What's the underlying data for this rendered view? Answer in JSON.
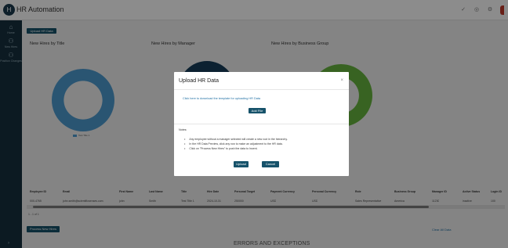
{
  "app": {
    "logo_text": "H",
    "title": "HR Automation"
  },
  "topbar": {
    "icon_glyphs": [
      "✓",
      "◎",
      "⚙"
    ]
  },
  "sidebar": {
    "items": [
      {
        "icon": "⌂",
        "label": "Home",
        "icon_name": "home-icon"
      },
      {
        "icon": "⚇",
        "label": "New Hires",
        "icon_name": "new-hires-icon"
      },
      {
        "icon": "⚇",
        "label": "Position Changes",
        "icon_name": "position-changes-icon"
      }
    ],
    "bottom_glyph": "›"
  },
  "main": {
    "upload_button": "Upload HR Data",
    "charts": [
      {
        "title": "New Hires by Title"
      },
      {
        "title": "New Hires by Manager"
      },
      {
        "title": "New Hires by Business Group"
      }
    ],
    "legend_label": "Test Title 1",
    "table": {
      "headers": [
        "Employee ID",
        "Email",
        "First Name",
        "Last Name",
        "Title",
        "Hire Date",
        "Personal Target",
        "Payment Currency",
        "Personal Currency",
        "Role",
        "Business Group",
        "Manager ID",
        "Active Status",
        "Login ID"
      ],
      "row": [
        "000-4765",
        "john.smith@scientificsenses.com",
        "john",
        "Smith",
        "Test Title 1",
        "2024-10-31",
        "250000",
        "USD",
        "USD",
        "Sales Representative",
        "America",
        "11230",
        "inactive",
        "100"
      ]
    },
    "pager": "1 - 1 of 1",
    "process_button": "Process New Hires",
    "clear_link": "Clear All Data",
    "errors_title": "ERRORS AND EXCEPTIONS"
  },
  "modal": {
    "title": "Upload HR Data",
    "close": "×",
    "template_link": "Click here to download the template for uploading HR Data",
    "add_file_button": "Add File",
    "notes_label": "Notes:",
    "notes": [
      "Any employee without a manager selected will create a new root in the hierarchy.",
      "In the HR Data Preview, click any row to make an adjustment to the HR data.",
      "Click on \"Process New Hires\" to push the data to Incent."
    ],
    "upload_button": "Upload",
    "cancel_button": "Cancel"
  },
  "colors": {
    "sidebar": "#16313f",
    "accent": "#16526a",
    "donut_blue": "#4d9bd0",
    "donut_navy": "#163d59",
    "donut_green": "#67b43e",
    "link": "#1f6fa3"
  }
}
